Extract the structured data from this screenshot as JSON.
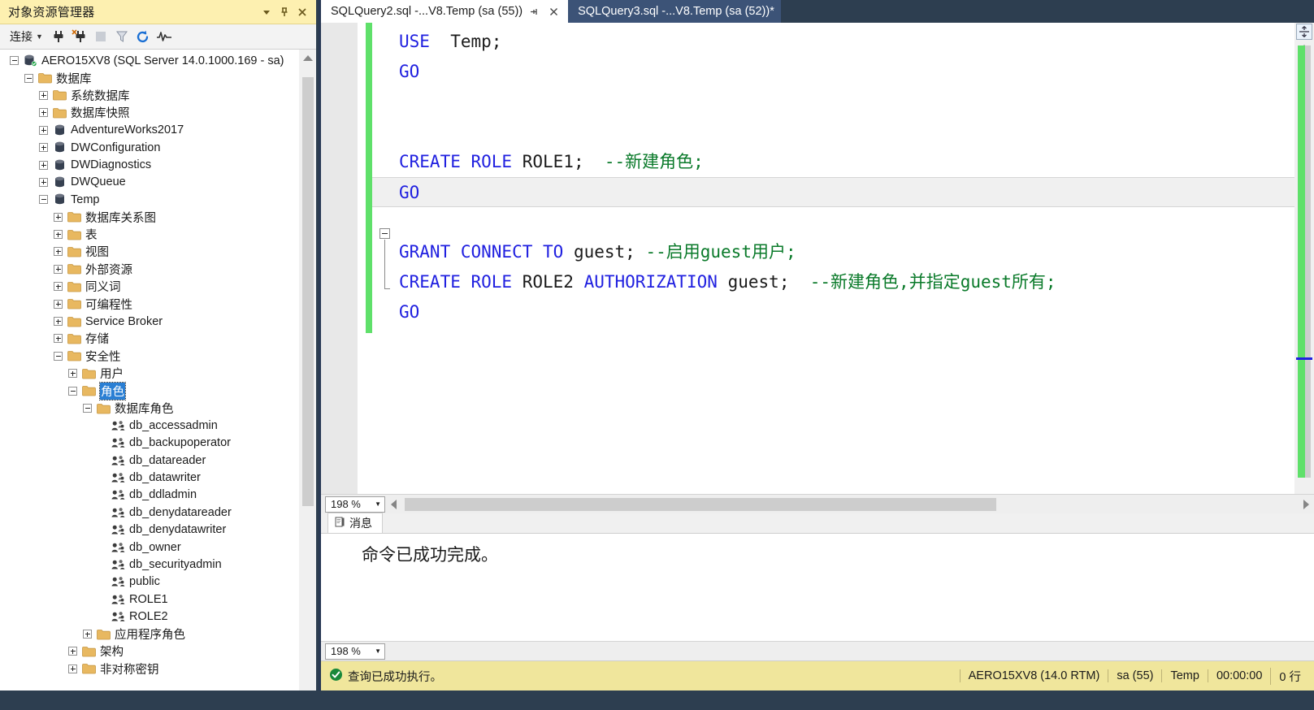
{
  "explorer": {
    "title": "对象资源管理器",
    "title_buttons": [
      {
        "name": "dropdown-icon",
        "glyph": "▾"
      },
      {
        "name": "pin-icon",
        "glyph": "pin"
      },
      {
        "name": "close-icon",
        "glyph": "✕"
      }
    ],
    "toolbar": {
      "connect_label": "连接",
      "connect_caret": "▾",
      "icons": [
        "connect-plug-icon",
        "disconnect-plug-icon",
        "stop-icon",
        "filter-icon",
        "refresh-icon",
        "activity-monitor-icon"
      ]
    },
    "tree": [
      {
        "depth": 0,
        "twisty": "minus",
        "icon": "server-icon",
        "label": "AERO15XV8 (SQL Server 14.0.1000.169 - sa)",
        "selected": false
      },
      {
        "depth": 1,
        "twisty": "minus",
        "icon": "folder-icon",
        "label": "数据库",
        "selected": false
      },
      {
        "depth": 2,
        "twisty": "plus",
        "icon": "folder-icon",
        "label": "系统数据库",
        "selected": false
      },
      {
        "depth": 2,
        "twisty": "plus",
        "icon": "folder-icon",
        "label": "数据库快照",
        "selected": false
      },
      {
        "depth": 2,
        "twisty": "plus",
        "icon": "database-icon",
        "label": "AdventureWorks2017",
        "selected": false
      },
      {
        "depth": 2,
        "twisty": "plus",
        "icon": "database-icon",
        "label": "DWConfiguration",
        "selected": false
      },
      {
        "depth": 2,
        "twisty": "plus",
        "icon": "database-icon",
        "label": "DWDiagnostics",
        "selected": false
      },
      {
        "depth": 2,
        "twisty": "plus",
        "icon": "database-icon",
        "label": "DWQueue",
        "selected": false
      },
      {
        "depth": 2,
        "twisty": "minus",
        "icon": "database-icon",
        "label": "Temp",
        "selected": false
      },
      {
        "depth": 3,
        "twisty": "plus",
        "icon": "folder-icon",
        "label": "数据库关系图",
        "selected": false
      },
      {
        "depth": 3,
        "twisty": "plus",
        "icon": "folder-icon",
        "label": "表",
        "selected": false
      },
      {
        "depth": 3,
        "twisty": "plus",
        "icon": "folder-icon",
        "label": "视图",
        "selected": false
      },
      {
        "depth": 3,
        "twisty": "plus",
        "icon": "folder-icon",
        "label": "外部资源",
        "selected": false
      },
      {
        "depth": 3,
        "twisty": "plus",
        "icon": "folder-icon",
        "label": "同义词",
        "selected": false
      },
      {
        "depth": 3,
        "twisty": "plus",
        "icon": "folder-icon",
        "label": "可编程性",
        "selected": false
      },
      {
        "depth": 3,
        "twisty": "plus",
        "icon": "folder-icon",
        "label": "Service Broker",
        "selected": false
      },
      {
        "depth": 3,
        "twisty": "plus",
        "icon": "folder-icon",
        "label": "存储",
        "selected": false
      },
      {
        "depth": 3,
        "twisty": "minus",
        "icon": "folder-icon",
        "label": "安全性",
        "selected": false
      },
      {
        "depth": 4,
        "twisty": "plus",
        "icon": "folder-icon",
        "label": "用户",
        "selected": false
      },
      {
        "depth": 4,
        "twisty": "minus",
        "icon": "folder-icon",
        "label": "角色",
        "selected": true
      },
      {
        "depth": 5,
        "twisty": "minus",
        "icon": "folder-icon",
        "label": "数据库角色",
        "selected": false
      },
      {
        "depth": 6,
        "twisty": "none",
        "icon": "role-icon",
        "label": "db_accessadmin",
        "selected": false
      },
      {
        "depth": 6,
        "twisty": "none",
        "icon": "role-icon",
        "label": "db_backupoperator",
        "selected": false
      },
      {
        "depth": 6,
        "twisty": "none",
        "icon": "role-icon",
        "label": "db_datareader",
        "selected": false
      },
      {
        "depth": 6,
        "twisty": "none",
        "icon": "role-icon",
        "label": "db_datawriter",
        "selected": false
      },
      {
        "depth": 6,
        "twisty": "none",
        "icon": "role-icon",
        "label": "db_ddladmin",
        "selected": false
      },
      {
        "depth": 6,
        "twisty": "none",
        "icon": "role-icon",
        "label": "db_denydatareader",
        "selected": false
      },
      {
        "depth": 6,
        "twisty": "none",
        "icon": "role-icon",
        "label": "db_denydatawriter",
        "selected": false
      },
      {
        "depth": 6,
        "twisty": "none",
        "icon": "role-icon",
        "label": "db_owner",
        "selected": false
      },
      {
        "depth": 6,
        "twisty": "none",
        "icon": "role-icon",
        "label": "db_securityadmin",
        "selected": false
      },
      {
        "depth": 6,
        "twisty": "none",
        "icon": "role-icon",
        "label": "public",
        "selected": false
      },
      {
        "depth": 6,
        "twisty": "none",
        "icon": "role-icon",
        "label": "ROLE1",
        "selected": false
      },
      {
        "depth": 6,
        "twisty": "none",
        "icon": "role-icon",
        "label": "ROLE2",
        "selected": false
      },
      {
        "depth": 5,
        "twisty": "plus",
        "icon": "folder-icon",
        "label": "应用程序角色",
        "selected": false
      },
      {
        "depth": 4,
        "twisty": "plus",
        "icon": "folder-icon",
        "label": "架构",
        "selected": false
      },
      {
        "depth": 4,
        "twisty": "plus",
        "icon": "folder-icon",
        "label": "非对称密钥",
        "selected": false
      }
    ]
  },
  "tabs": [
    {
      "label": "SQLQuery2.sql -...V8.Temp (sa (55))",
      "active": true,
      "pin": "⊣",
      "close": "✕"
    },
    {
      "label": "SQLQuery3.sql -...V8.Temp (sa (52))*",
      "active": false
    }
  ],
  "editor": {
    "zoom": "198 %",
    "zoom_caret": "▾",
    "lines": [
      {
        "current": false,
        "tokens": [
          {
            "t": "kw",
            "s": "USE"
          },
          {
            "t": "id",
            "s": "  Temp"
          },
          {
            "t": "cn",
            "s": ";"
          }
        ]
      },
      {
        "current": false,
        "tokens": [
          {
            "t": "kw",
            "s": "GO"
          }
        ]
      },
      {
        "current": false,
        "tokens": []
      },
      {
        "current": false,
        "tokens": []
      },
      {
        "current": false,
        "tokens": [
          {
            "t": "kw",
            "s": "CREATE ROLE"
          },
          {
            "t": "id",
            "s": " ROLE1"
          },
          {
            "t": "cn",
            "s": ";"
          },
          {
            "t": "cm",
            "s": "  --新建角色;"
          }
        ]
      },
      {
        "current": true,
        "tokens": [
          {
            "t": "kw",
            "s": "GO"
          }
        ]
      },
      {
        "current": false,
        "tokens": []
      },
      {
        "current": false,
        "tokens": [
          {
            "t": "kw",
            "s": "GRANT CONNECT TO"
          },
          {
            "t": "id",
            "s": " guest"
          },
          {
            "t": "cn",
            "s": ";"
          },
          {
            "t": "cm",
            "s": " --启用guest用户;"
          }
        ]
      },
      {
        "current": false,
        "tokens": [
          {
            "t": "kw",
            "s": "CREATE ROLE"
          },
          {
            "t": "id",
            "s": " ROLE2 "
          },
          {
            "t": "kw",
            "s": "AUTHORIZATION"
          },
          {
            "t": "id",
            "s": " guest"
          },
          {
            "t": "cn",
            "s": ";"
          },
          {
            "t": "cm",
            "s": "  --新建角色,并指定guest所有;"
          }
        ]
      },
      {
        "current": false,
        "tokens": [
          {
            "t": "kw",
            "s": "GO"
          }
        ]
      }
    ]
  },
  "results": {
    "zoom": "198 %",
    "zoom_caret": "▾",
    "tab_label": "消息",
    "tab_icon": "message-icon",
    "message": "命令已成功完成。"
  },
  "status": {
    "icon": "success-check-icon",
    "text": "查询已成功执行。",
    "segments": [
      "AERO15XV8 (14.0 RTM)",
      "sa (55)",
      "Temp",
      "00:00:00",
      "0 行"
    ]
  },
  "colors": {
    "panel_title_bg": "#fdf0b0",
    "status_bg": "#f0e69c",
    "chrome": "#2d3e50",
    "tab_inactive": "#3c5377",
    "selection": "#2a7fd4",
    "keyword": "#2020e0",
    "comment": "#0a7a2a",
    "changebar": "#5fe06a"
  }
}
